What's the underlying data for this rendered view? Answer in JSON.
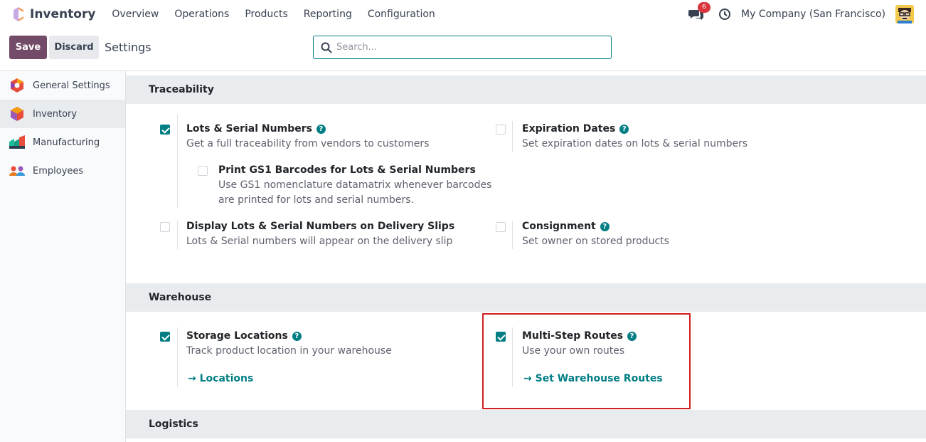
{
  "topnav": {
    "app_name": "Inventory",
    "menu": [
      "Overview",
      "Operations",
      "Products",
      "Reporting",
      "Configuration"
    ],
    "message_count": "6",
    "company": "My Company (San Francisco)"
  },
  "control": {
    "save_label": "Save",
    "discard_label": "Discard",
    "title": "Settings",
    "search_placeholder": "Search..."
  },
  "sidebar": {
    "items": [
      {
        "label": "General Settings",
        "icon": "general-settings-icon"
      },
      {
        "label": "Inventory",
        "icon": "inventory-app-icon",
        "active": true
      },
      {
        "label": "Manufacturing",
        "icon": "manufacturing-app-icon"
      },
      {
        "label": "Employees",
        "icon": "employees-app-icon"
      }
    ]
  },
  "sections": {
    "traceability": {
      "title": "Traceability",
      "lots": {
        "label": "Lots & Serial Numbers",
        "desc": "Get a full traceability from vendors to customers",
        "checked": true
      },
      "gs1": {
        "label": "Print GS1 Barcodes for Lots & Serial Numbers",
        "desc1": "Use GS1 nomenclature datamatrix whenever barcodes",
        "desc2": "are printed for lots and serial numbers.",
        "checked": false
      },
      "display_lots": {
        "label": "Display Lots & Serial Numbers on Delivery Slips",
        "desc": "Lots & Serial numbers will appear on the delivery slip",
        "checked": false
      },
      "expiration": {
        "label": "Expiration Dates",
        "desc": "Set expiration dates on lots & serial numbers",
        "checked": false
      },
      "consignment": {
        "label": "Consignment",
        "desc": "Set owner on stored products",
        "checked": false
      }
    },
    "warehouse": {
      "title": "Warehouse",
      "storage": {
        "label": "Storage Locations",
        "desc": "Track product location in your warehouse",
        "link": "Locations",
        "checked": true
      },
      "multistep": {
        "label": "Multi-Step Routes",
        "desc": "Use your own routes",
        "link": "Set Warehouse Routes",
        "checked": true
      }
    },
    "logistics": {
      "title": "Logistics"
    }
  },
  "colors": {
    "primary": "#714b67",
    "accent": "#017e84",
    "highlight": "#d21f1f"
  }
}
